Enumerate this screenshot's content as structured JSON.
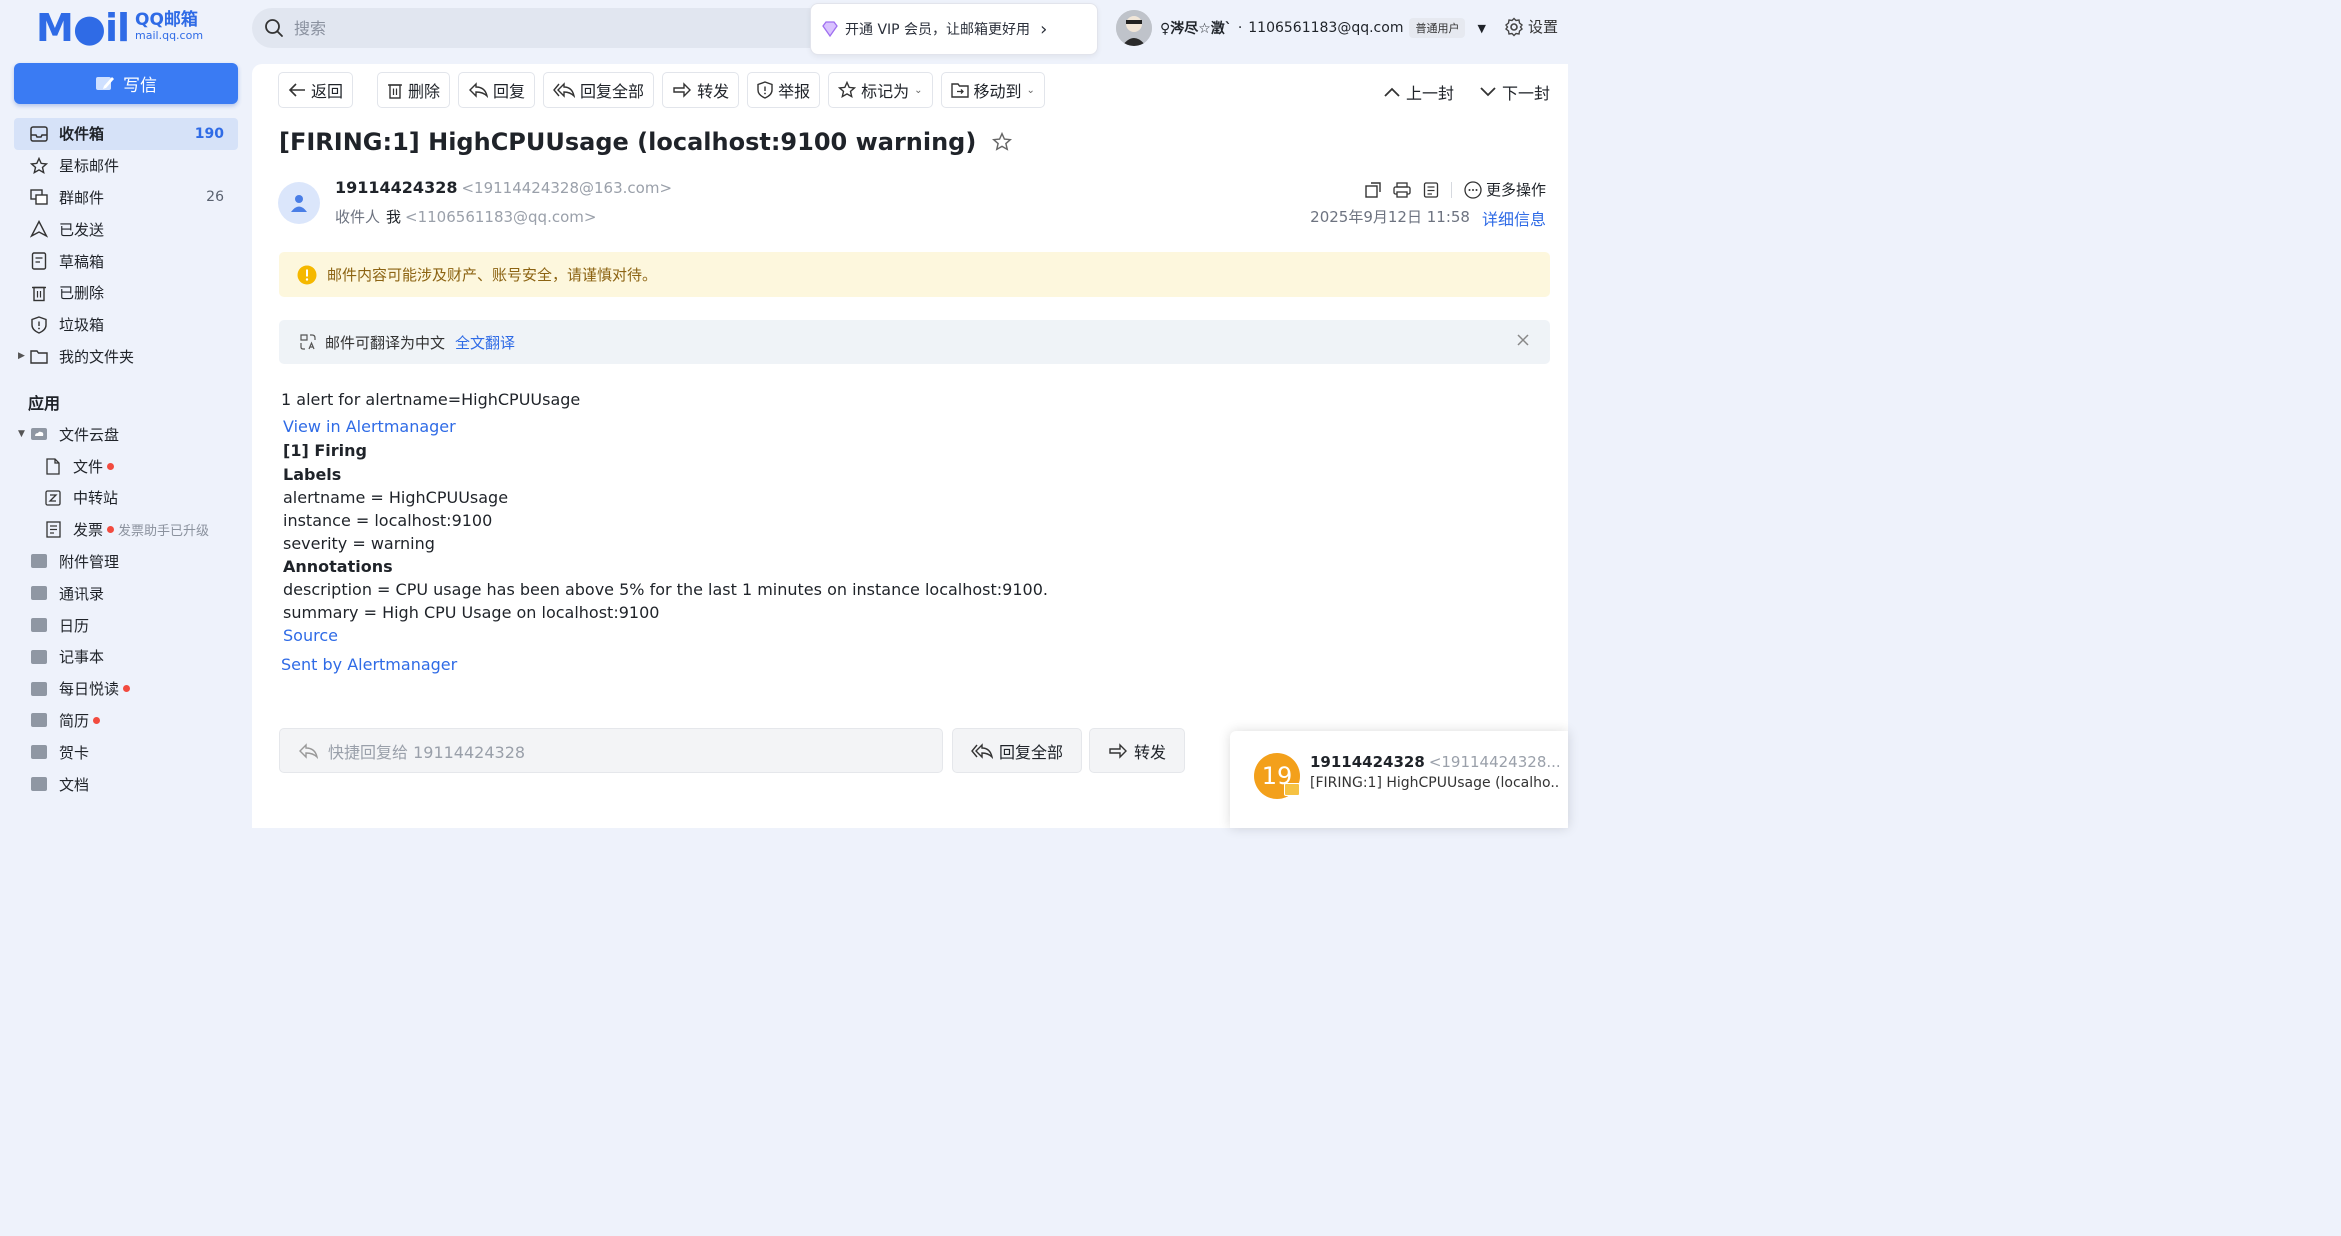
{
  "logo": {
    "mark": "M●il",
    "name": "QQ邮箱",
    "domain": "mail.qq.com"
  },
  "search": {
    "placeholder": "搜索"
  },
  "vip": {
    "label": "开通 VIP 会员，让邮箱更好用",
    "chevron": "›"
  },
  "user": {
    "nickname": "♀涔尽☆澂`",
    "dot": "·",
    "email": "1106561183@qq.com",
    "tier": "普通用户"
  },
  "settings": {
    "label": "设置"
  },
  "compose": {
    "label": "写信"
  },
  "nav": [
    {
      "label": "收件箱",
      "count": "190",
      "icon": "inbox-icon"
    },
    {
      "label": "星标邮件",
      "count": "",
      "icon": "star-icon"
    },
    {
      "label": "群邮件",
      "count": "26",
      "icon": "group-mail-icon"
    },
    {
      "label": "已发送",
      "count": "",
      "icon": "sent-icon"
    },
    {
      "label": "草稿箱",
      "count": "",
      "icon": "drafts-icon"
    },
    {
      "label": "已删除",
      "count": "",
      "icon": "trash-icon"
    },
    {
      "label": "垃圾箱",
      "count": "",
      "icon": "spam-icon"
    },
    {
      "label": "我的文件夹",
      "count": "",
      "icon": "folder-icon"
    }
  ],
  "apps": {
    "section_label": "应用",
    "cloud": "文件云盘",
    "cloud_files": "文件",
    "cloud_transfer": "中转站",
    "cloud_invoice": "发票",
    "invoice_note": "发票助手已升级",
    "items": [
      "附件管理",
      "通讯录",
      "日历",
      "记事本",
      "每日悦读",
      "简历",
      "贺卡",
      "文档"
    ]
  },
  "toolbar": {
    "back": "返回",
    "delete": "删除",
    "reply": "回复",
    "reply_all": "回复全部",
    "forward": "转发",
    "report": "举报",
    "mark_as": "标记为",
    "move_to": "移动到",
    "prev": "上一封",
    "next": "下一封"
  },
  "mail": {
    "subject": "[FIRING:1] HighCPUUsage (localhost:9100 warning)",
    "sender_name": "19114424328",
    "sender_addr": "<19114424328@163.com>",
    "recipient_label": "收件人",
    "recipient_name": "我",
    "recipient_addr": "<1106561183@qq.com>",
    "more_actions": "更多操作",
    "date": "2025年9月12日 11:58",
    "details": "详细信息",
    "warning": "邮件内容可能涉及财产、账号安全，请谨慎对待。",
    "translate_hint": "邮件可翻译为中文",
    "translate_link": "全文翻译"
  },
  "body": {
    "line1": "1 alert for alertname=HighCPUUsage",
    "view_link": "View in Alertmanager",
    "firing": "[1] Firing",
    "labels_heading": "Labels",
    "label_alertname": "alertname = HighCPUUsage",
    "label_instance": "instance = localhost:9100",
    "label_severity": "severity = warning",
    "annotations_heading": "Annotations",
    "ann_description": "description = CPU usage has been above 5% for the last 1 minutes on instance localhost:9100.",
    "ann_summary": "summary = High CPU Usage on localhost:9100",
    "source_link": "Source",
    "sent_by_link": "Sent by Alertmanager"
  },
  "reply_bar": {
    "quick_reply_placeholder": "快捷回复给 19114424328",
    "reply_all": "回复全部",
    "forward": "转发"
  },
  "notification": {
    "avatar_text": "19",
    "sender": "19114424328",
    "sender_addr": "<19114424328...",
    "subject": "[FIRING:1] HighCPUUsage (localho..."
  },
  "colors": {
    "accent": "#2f6be6",
    "compose": "#3a7bf3",
    "warning_bg": "#fdf7dd",
    "badge_red": "#f24b3f",
    "notify_avatar": "#f3a01b"
  }
}
